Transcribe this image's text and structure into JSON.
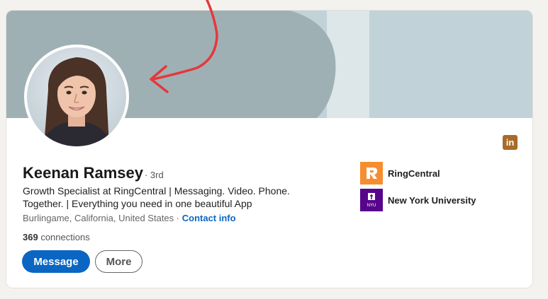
{
  "profile": {
    "name": "Keenan Ramsey",
    "degree": "· 3rd",
    "headline": "Growth Specialist at RingCentral | Messaging. Video. Phone. Together. | Everything you need in one beautiful App",
    "location": "Burlingame, California, United States",
    "location_separator": " · ",
    "contact_info": "Contact info",
    "connections_count": "369",
    "connections_label": " connections"
  },
  "actions": {
    "message": "Message",
    "more": "More"
  },
  "organizations": [
    {
      "name": "RingCentral",
      "logo_text": "R",
      "logo_color": "#f68e31"
    },
    {
      "name": "New York University",
      "logo_text": "NYU",
      "logo_color": "#57068c"
    }
  ],
  "social_icon": {
    "icon": "linkedin-icon",
    "text": "in",
    "color": "#a86b2a"
  },
  "colors": {
    "accent": "#0a66c2",
    "annotation_arrow": "#e5383b",
    "banner": "#9fb0b4"
  }
}
